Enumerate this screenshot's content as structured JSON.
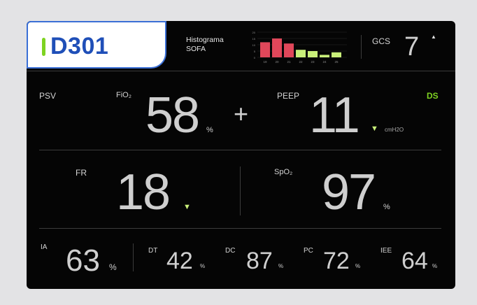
{
  "bed": {
    "id": "D301"
  },
  "histogram": {
    "title_line1": "Histograma",
    "title_line2": "SOFA",
    "days": [
      "19",
      "20",
      "21",
      "22",
      "23",
      "24",
      "25"
    ],
    "y_ticks": [
      "20",
      "15",
      "10",
      "5",
      "0"
    ],
    "values": [
      12,
      15,
      11,
      6,
      5,
      2,
      4
    ],
    "colors": [
      "#e0475a",
      "#e0475a",
      "#e0475a",
      "#c9f07a",
      "#c9f07a",
      "#c9f07a",
      "#c9f07a"
    ]
  },
  "gcs": {
    "label": "GCS",
    "value": "7",
    "trend": "▲"
  },
  "mode": {
    "label": "PSV",
    "flag": "DS"
  },
  "fio2": {
    "label": "FiO₂",
    "value": "58",
    "unit": "%"
  },
  "plus": "+",
  "peep": {
    "label": "PEEP",
    "value": "11",
    "unit": "cmH2O",
    "trend": "▼"
  },
  "fr": {
    "label": "FR",
    "value": "18",
    "trend": "▼"
  },
  "spo2": {
    "label": "SpO₂",
    "value": "97",
    "unit": "%"
  },
  "bottom": [
    {
      "label": "IA",
      "value": "63",
      "unit": "%"
    },
    {
      "label": "DT",
      "value": "42",
      "unit": "%"
    },
    {
      "label": "DC",
      "value": "87",
      "unit": "%"
    },
    {
      "label": "PC",
      "value": "72",
      "unit": "%"
    },
    {
      "label": "IEE",
      "value": "64",
      "unit": "%"
    }
  ],
  "colors": {
    "accent_green": "#7ed321",
    "bed_blue": "#1f4fb8",
    "sofa_high": "#e0475a",
    "sofa_low": "#c9f07a"
  }
}
